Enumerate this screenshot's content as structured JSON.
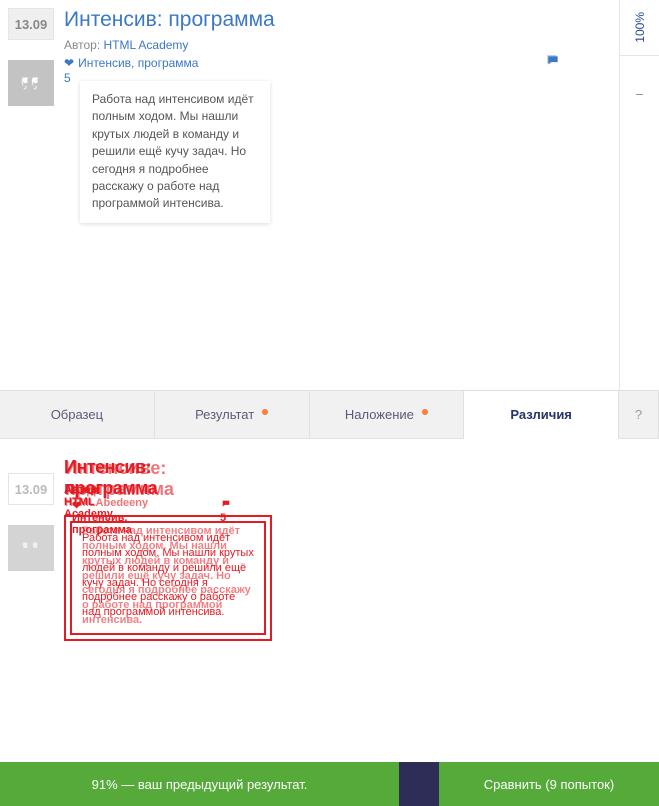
{
  "post": {
    "date": "13.09",
    "title": "Интенсив: программа",
    "author_label": "Автор:",
    "author": "HTML Academy",
    "tags": "Интенсив, программа",
    "comments": "5",
    "excerpt": "Работа над интенсивом идёт полным ходом. Мы нашли крутых людей в команду и решили ещё кучу задач. Но сегодня я подробнее расскажу о работе над программой интенсива."
  },
  "side": {
    "progress": "100%",
    "dash": "–"
  },
  "tabs": {
    "sample": "Образец",
    "result": "Результат",
    "overlay": "Наложение",
    "diff": "Различия",
    "help": "?"
  },
  "diff": {
    "date": "13.09",
    "title_a": "Интенсив: программа",
    "title_b": "Интенсиве: програмима",
    "author_a": "Автор: HTML Academy",
    "author_b": "Ahupp HTMLAbedeeny",
    "tags": "Интенсив, программа",
    "c5": "5",
    "excerpt": "Работа над интенсивом идёт полным ходом. Мы нашли крутых людей в команду и решили ещё кучу задач. Но сегодня я подробнее расскажу о работе над программой интенсива."
  },
  "bottom": {
    "prev": "91% — ваш предыдущий результат.",
    "compare": "Сравнить (9 попыток)"
  }
}
